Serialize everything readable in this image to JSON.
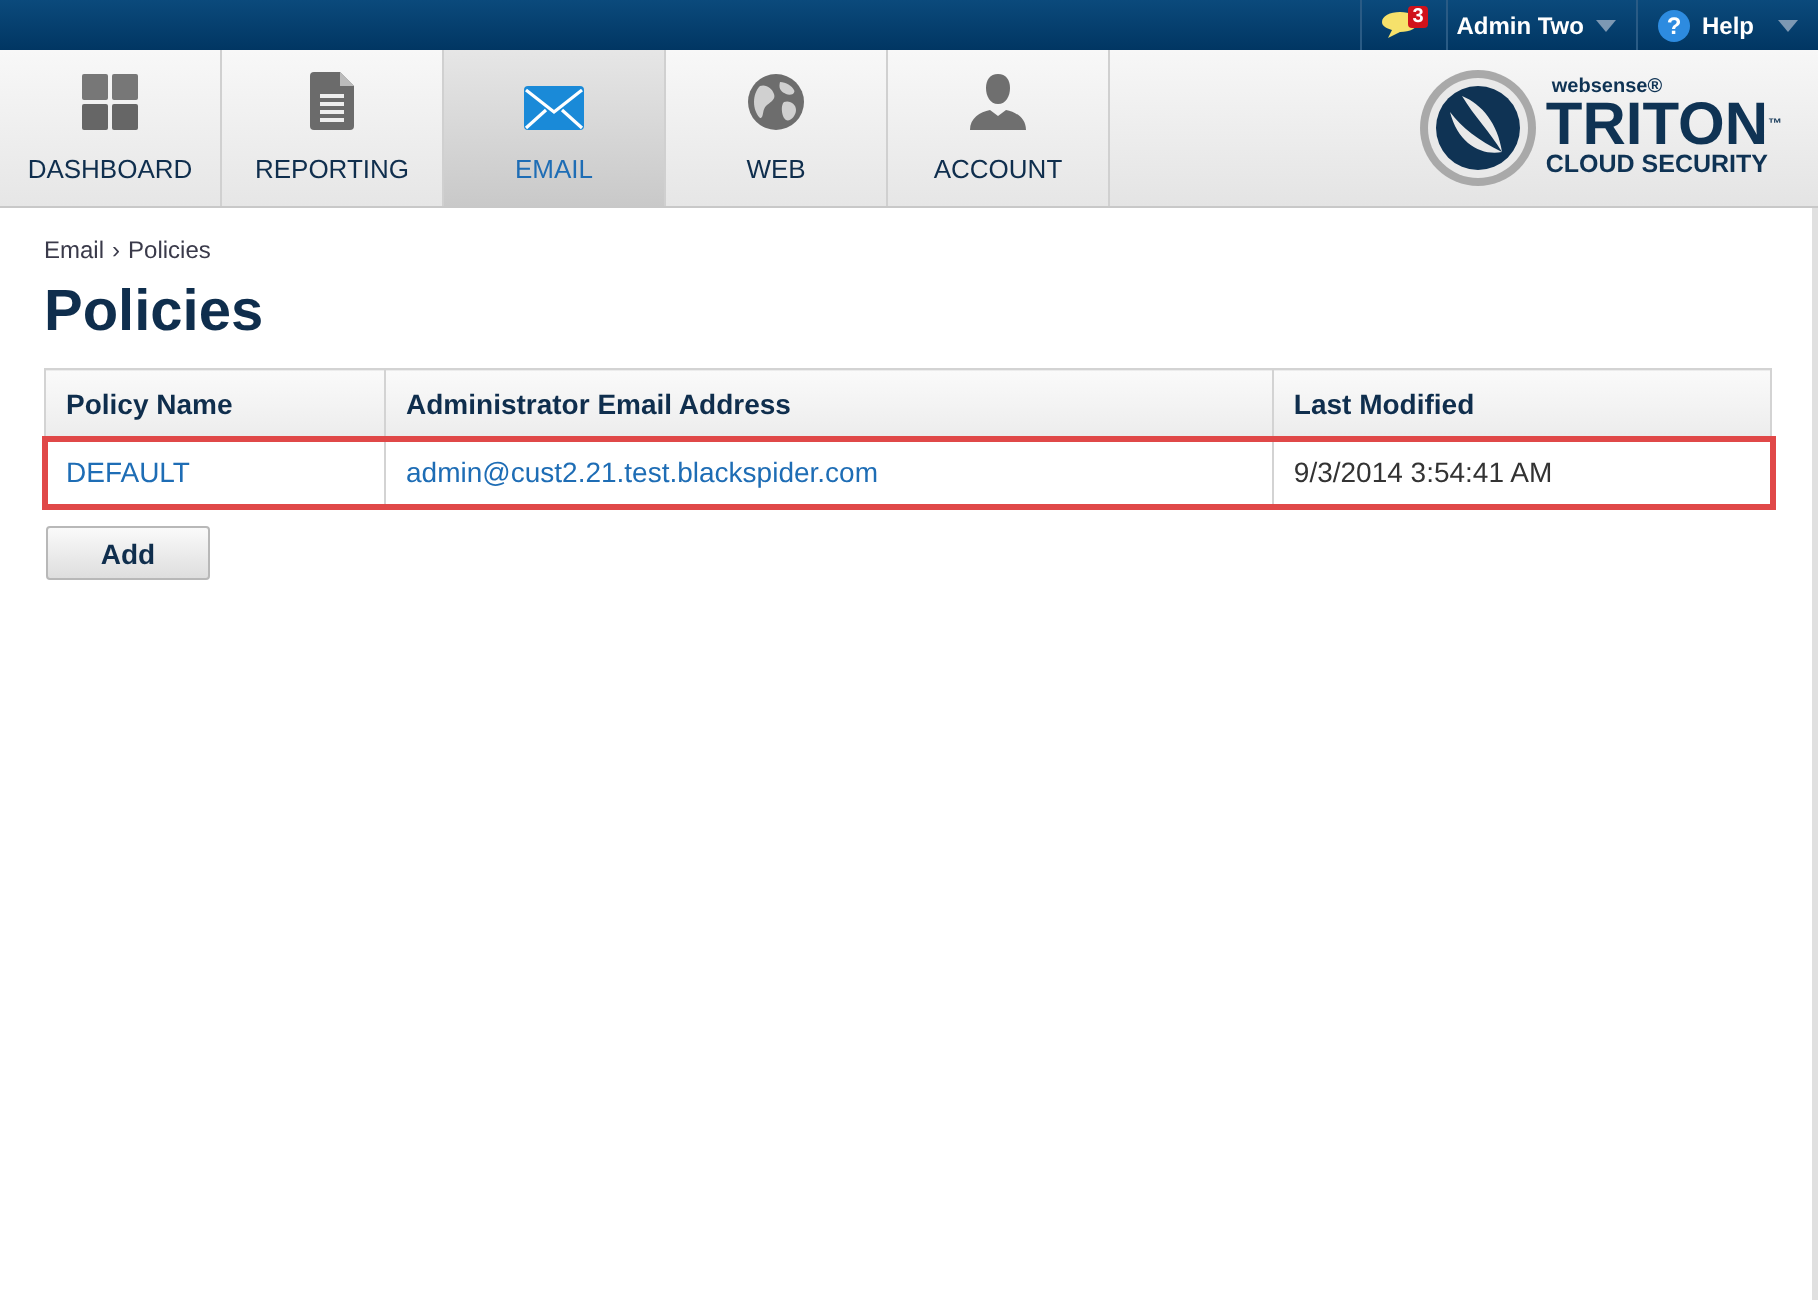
{
  "top_bar": {
    "notifications": {
      "count": "3"
    },
    "user": {
      "label": "Admin Two"
    },
    "help": {
      "icon": "?",
      "label": "Help"
    }
  },
  "nav_tabs": [
    {
      "kind": "dashboard",
      "label": "DASHBOARD",
      "selected": false
    },
    {
      "kind": "reporting",
      "label": "REPORTING",
      "selected": false
    },
    {
      "kind": "email",
      "label": "EMAIL",
      "selected": true
    },
    {
      "kind": "web",
      "label": "WEB",
      "selected": false
    },
    {
      "kind": "account",
      "label": "ACCOUNT",
      "selected": false
    }
  ],
  "logo": {
    "brand": "websense®",
    "product": "TRITON$^{™}$",
    "tagline": "CLOUD SECURITY"
  },
  "breadcrumb": [
    {
      "label": "Email"
    },
    {
      "label": "Policies"
    }
  ],
  "breadcrumb_separator": "›",
  "page_title": "Policies",
  "table": {
    "columns": [
      "Policy Name",
      "Administrator Email Address",
      "Last Modified"
    ],
    "rows": [
      {
        "cells": [
          "DEFAULT",
          "admin@cust2.21.test.blackspider.com",
          "9/3/2014 3:54:41 AM"
        ],
        "highlighted": true
      }
    ]
  },
  "buttons": [
    {
      "label": "Add"
    }
  ]
}
